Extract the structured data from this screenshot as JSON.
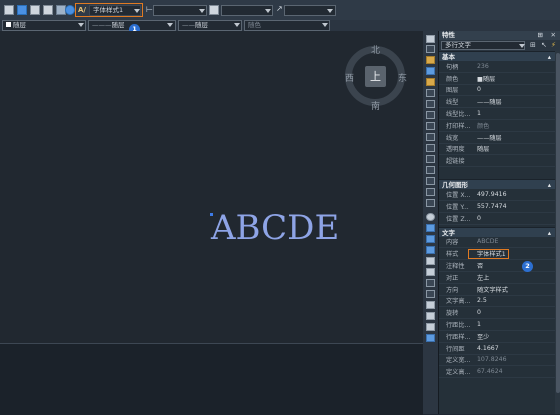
{
  "toolbar": {
    "text_style_combo": "字体样式1",
    "linetype_combo_1": "随层",
    "linetype_combo_2": "随层",
    "linetype_combo_3": "随层",
    "color_combo": "随色",
    "callout_1": "1"
  },
  "compass": {
    "north": "北",
    "south": "南",
    "east": "东",
    "west": "西",
    "center": "上"
  },
  "canvas": {
    "sample_text": "ABCDE"
  },
  "properties": {
    "title": "特性",
    "object_type": "多行文字",
    "sections": {
      "basic": "基本",
      "geometry": "几何图形",
      "text": "文字"
    },
    "basic_rows": [
      {
        "key": "句柄",
        "value": "236",
        "dim": true
      },
      {
        "key": "颜色",
        "value": "■随层",
        "dim": false
      },
      {
        "key": "图层",
        "value": "0",
        "dim": false
      },
      {
        "key": "线型",
        "value": "——随层",
        "dim": false
      },
      {
        "key": "线型比...",
        "value": "1",
        "dim": false
      },
      {
        "key": "打印样...",
        "value": "颜色",
        "dim": true
      },
      {
        "key": "线宽",
        "value": "——随层",
        "dim": false
      },
      {
        "key": "透明度",
        "value": "随层",
        "dim": false
      },
      {
        "key": "超链接",
        "value": "",
        "dim": false
      }
    ],
    "geometry_rows": [
      {
        "key": "位置 X...",
        "value": "497.9416",
        "dim": false
      },
      {
        "key": "位置 Y...",
        "value": "557.7474",
        "dim": false
      },
      {
        "key": "位置 Z...",
        "value": "0",
        "dim": false
      }
    ],
    "text_rows": [
      {
        "key": "内容",
        "value": "ABCDE",
        "dim": true
      },
      {
        "key": "样式",
        "value": "字体样式1",
        "dim": false
      },
      {
        "key": "注释性",
        "value": "否",
        "dim": false
      },
      {
        "key": "对正",
        "value": "左上",
        "dim": false
      },
      {
        "key": "方向",
        "value": "随文字样式",
        "dim": false
      },
      {
        "key": "文字高...",
        "value": "2.5",
        "dim": false
      },
      {
        "key": "旋转",
        "value": "0",
        "dim": false
      },
      {
        "key": "行距比...",
        "value": "1",
        "dim": false
      },
      {
        "key": "行距样...",
        "value": "至少",
        "dim": false
      },
      {
        "key": "行间距",
        "value": "4.1667",
        "dim": false
      },
      {
        "key": "定义宽...",
        "value": "107.8246",
        "dim": true
      },
      {
        "key": "定义高...",
        "value": "67.4624",
        "dim": true
      }
    ],
    "callout_2": "2"
  }
}
